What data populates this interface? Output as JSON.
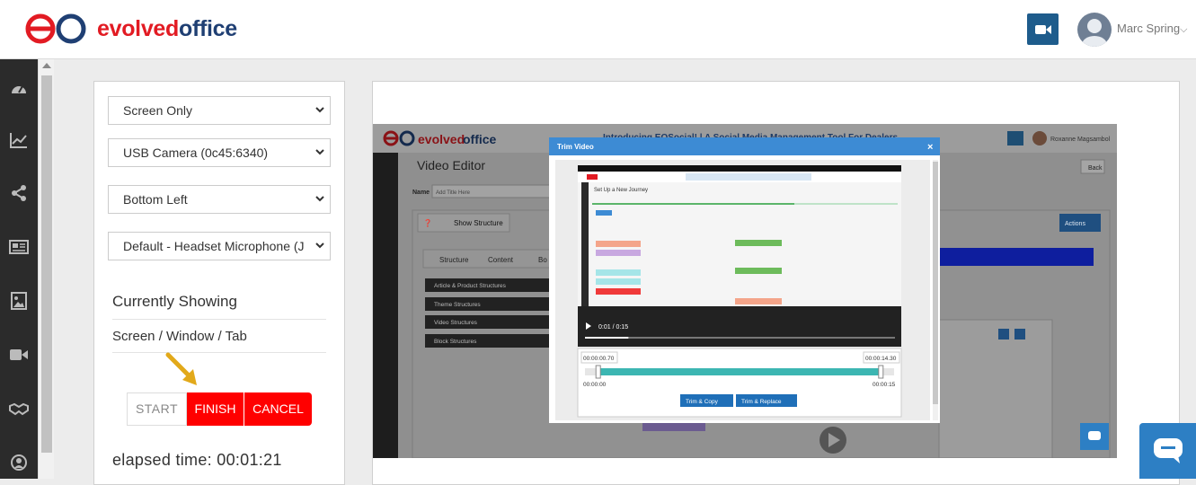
{
  "header": {
    "brand_part1": "evolved",
    "brand_part2": "office",
    "camera_button_icon": "video-camera-icon",
    "user_name": "Marc Spring"
  },
  "sidebar": {
    "items": [
      {
        "icon": "dashboard-icon"
      },
      {
        "icon": "line-chart-icon"
      },
      {
        "icon": "share-icon"
      },
      {
        "icon": "newspaper-icon"
      },
      {
        "icon": "image-icon"
      },
      {
        "icon": "video-camera-icon"
      },
      {
        "icon": "handshake-icon"
      },
      {
        "icon": "user-circle-icon"
      }
    ]
  },
  "recorder": {
    "capture_source": "Screen Only",
    "camera": "USB Camera (0c45:6340)",
    "camera_position": "Bottom Left",
    "microphone": "Default - Headset Microphone (J",
    "currently_showing_label": "Currently Showing",
    "currently_showing_value": "Screen / Window / Tab",
    "start_label": "START",
    "finish_label": "FINISH",
    "cancel_label": "CANCEL",
    "elapsed_label": "elapsed time: 00:01:21"
  },
  "preview": {
    "inner_brand_part1": "evolved",
    "inner_brand_part2": "office",
    "inner_banner": "Introducing EOSocial! | A Social Media Management Tool For Dealers",
    "inner_user": "Roxanne Magsambol",
    "video_editor_title": "Video Editor",
    "back_label": "Back",
    "name_label": "Name",
    "name_placeholder": "Add Title Here",
    "show_structure": "Show Structure",
    "actions_label": "Actions",
    "tabs": [
      "Structure",
      "Content",
      "Bo"
    ],
    "structure_items": [
      "Article & Product Structures",
      "Theme Structures",
      "Video Structures",
      "Block Structures"
    ],
    "modal": {
      "title": "Trim Video",
      "close": "×",
      "video_time": "0:01 / 0:15",
      "video_page_title": "Set Up a New Journey",
      "trim_start": "00:00:00.70",
      "trim_end": "00:00:14.30",
      "range_min": "00:00:00",
      "range_max": "00:00:15",
      "trim_copy": "Trim & Copy",
      "trim_replace": "Trim & Replace",
      "trim_start_fraction": 0.05,
      "trim_end_fraction": 0.95,
      "playback_fraction": 0.14
    }
  },
  "colors": {
    "brand_red": "#e21b23",
    "brand_navy": "#1f3f73",
    "button_red": "#ff0000",
    "accent_blue": "#1e5c8c",
    "teal": "#3cb6b2",
    "modal_blue": "#3d8bd4"
  }
}
